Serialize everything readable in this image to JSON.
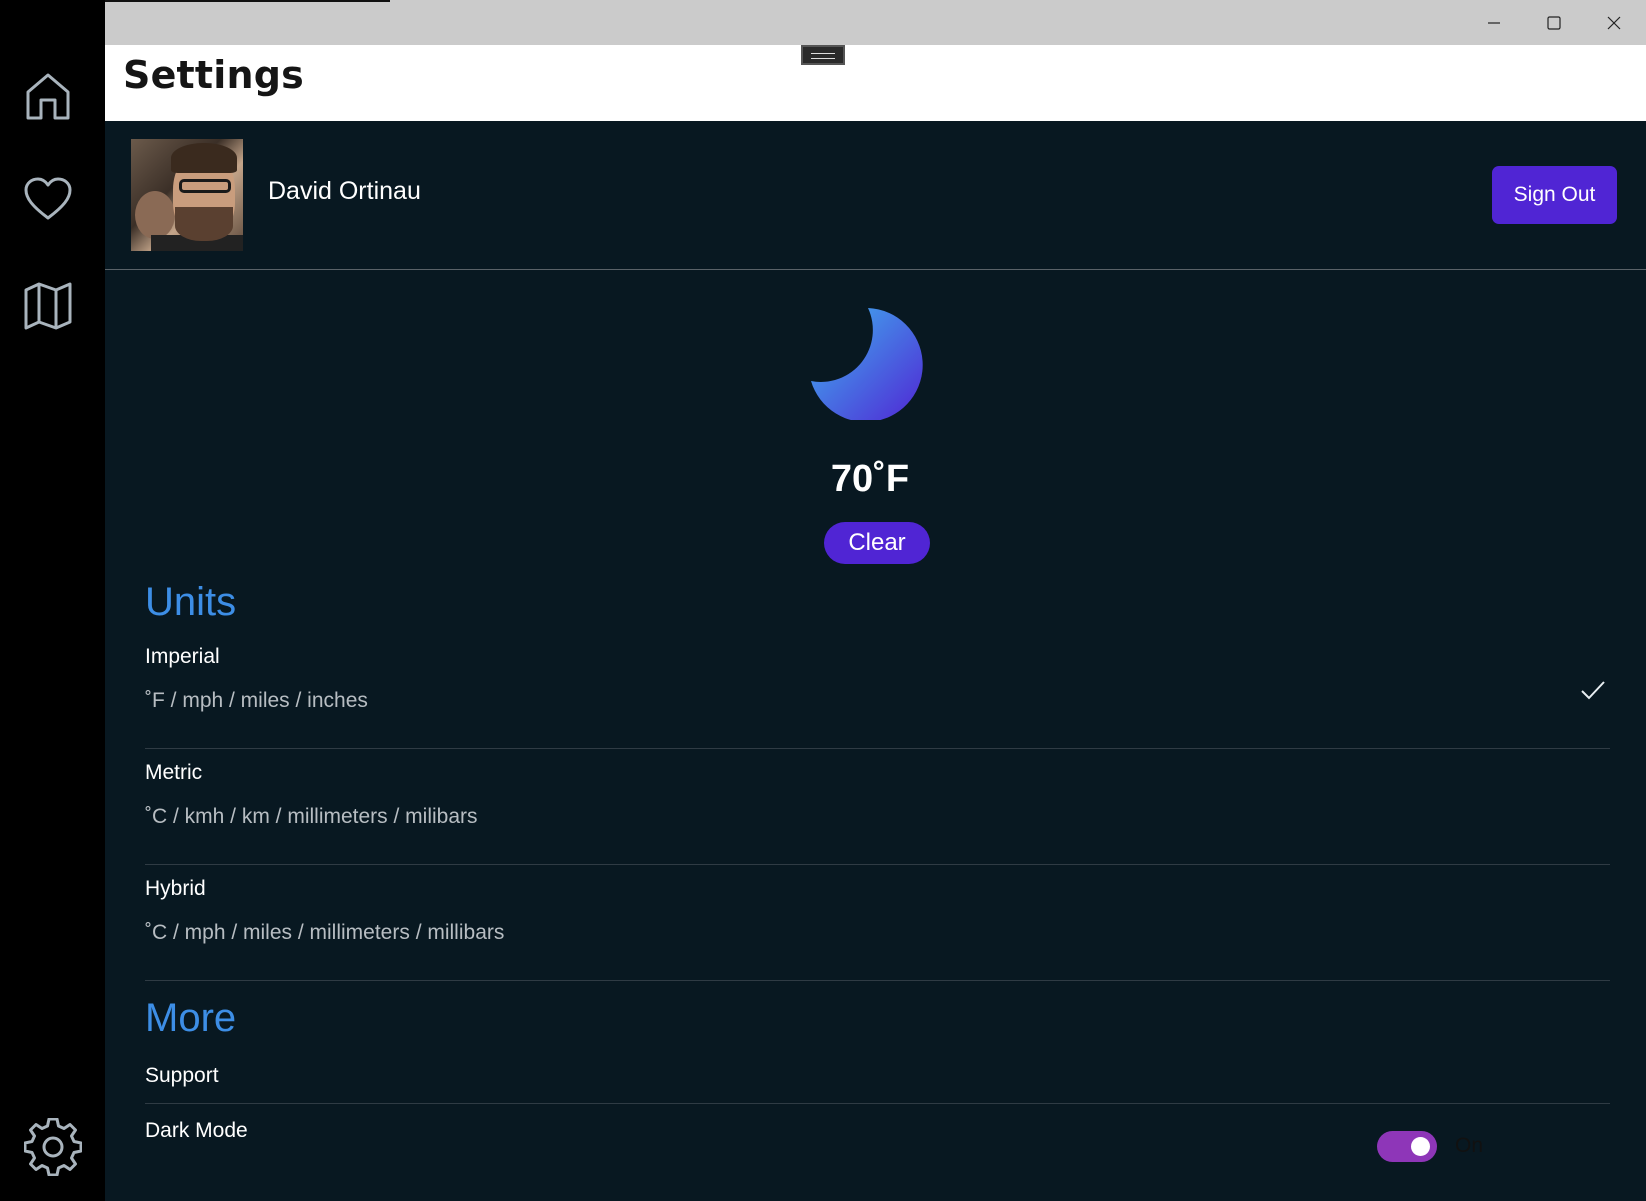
{
  "nav": {
    "items": [
      {
        "icon": "home-icon"
      },
      {
        "icon": "heart-icon"
      },
      {
        "icon": "map-icon"
      },
      {
        "icon": "gear-icon"
      }
    ]
  },
  "window": {
    "controls": [
      "minimize-icon",
      "maximize-icon",
      "close-icon"
    ]
  },
  "header": {
    "title": "Settings"
  },
  "profile": {
    "name": "David Ortinau",
    "sign_out_label": "Sign Out"
  },
  "weather": {
    "temperature": "70˚F",
    "condition": "Clear",
    "colors": {
      "gradient_start": "#3fb6f0",
      "gradient_end": "#5025d4"
    }
  },
  "units": {
    "title": "Units",
    "options": [
      {
        "label": "Imperial",
        "description": "˚F / mph / miles / inches",
        "selected": true
      },
      {
        "label": "Metric",
        "description": "˚C / kmh / km / millimeters / milibars",
        "selected": false
      },
      {
        "label": "Hybrid",
        "description": "˚C / mph / miles / millimeters / millibars",
        "selected": false
      }
    ]
  },
  "more": {
    "title": "More",
    "support_label": "Support",
    "dark_mode_label": "Dark Mode",
    "dark_mode_state": "On",
    "dark_mode_enabled": true
  },
  "colors": {
    "accent": "#5025d4",
    "section_title": "#3d8ee6",
    "toggle_on": "#8e36b8",
    "background": "#081821"
  }
}
